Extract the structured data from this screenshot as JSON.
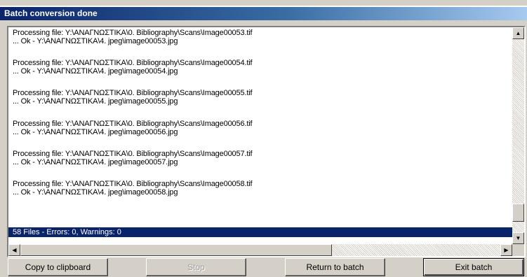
{
  "window": {
    "title": "Batch conversion done"
  },
  "log": {
    "entries": [
      {
        "processing": "Processing file: Y:\\ΑΝΑΓΝΩΣΤΙΚΑ\\0. Bibliography\\Scans\\Image00053.tif",
        "result": "... Ok - Y:\\ΑΝΑΓΝΩΣΤΙΚΑ\\4. jpeg\\image00053.jpg"
      },
      {
        "processing": "Processing file: Y:\\ΑΝΑΓΝΩΣΤΙΚΑ\\0. Bibliography\\Scans\\Image00054.tif",
        "result": "... Ok - Y:\\ΑΝΑΓΝΩΣΤΙΚΑ\\4. jpeg\\image00054.jpg"
      },
      {
        "processing": "Processing file: Y:\\ΑΝΑΓΝΩΣΤΙΚΑ\\0. Bibliography\\Scans\\Image00055.tif",
        "result": "... Ok - Y:\\ΑΝΑΓΝΩΣΤΙΚΑ\\4. jpeg\\image00055.jpg"
      },
      {
        "processing": "Processing file: Y:\\ΑΝΑΓΝΩΣΤΙΚΑ\\0. Bibliography\\Scans\\Image00056.tif",
        "result": "... Ok - Y:\\ΑΝΑΓΝΩΣΤΙΚΑ\\4. jpeg\\image00056.jpg"
      },
      {
        "processing": "Processing file: Y:\\ΑΝΑΓΝΩΣΤΙΚΑ\\0. Bibliography\\Scans\\Image00057.tif",
        "result": "... Ok - Y:\\ΑΝΑΓΝΩΣΤΙΚΑ\\4. jpeg\\image00057.jpg"
      },
      {
        "processing": "Processing file: Y:\\ΑΝΑΓΝΩΣΤΙΚΑ\\0. Bibliography\\Scans\\Image00058.tif",
        "result": "... Ok - Y:\\ΑΝΑΓΝΩΣΤΙΚΑ\\4. jpeg\\image00058.jpg"
      }
    ],
    "summary": "58 Files - Errors: 0, Warnings: 0"
  },
  "scrollbar": {
    "up_icon": "arrow-up-icon",
    "down_icon": "arrow-down-icon",
    "left_icon": "arrow-left-icon",
    "right_icon": "arrow-right-icon"
  },
  "buttons": {
    "copy": "Copy to clipboard",
    "stop": "Stop",
    "return": "Return to batch",
    "exit": "Exit batch"
  }
}
